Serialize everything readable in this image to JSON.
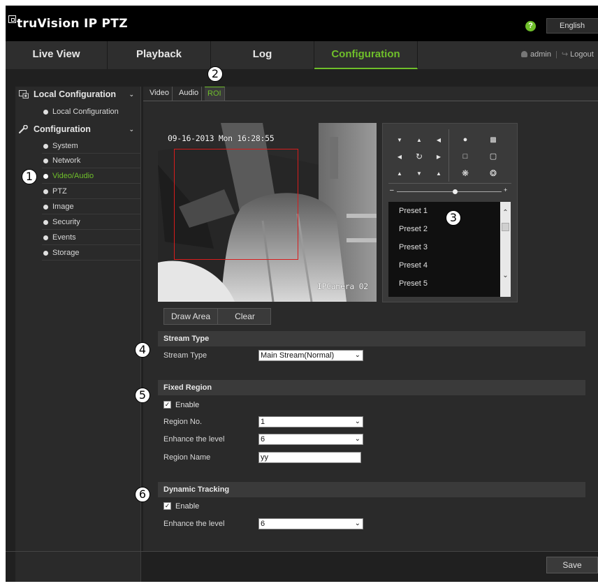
{
  "header": {
    "logo_text": "truVision IP PTZ",
    "help_icon": "question-icon",
    "language": "English"
  },
  "nav": {
    "tabs": [
      {
        "label": "Live View"
      },
      {
        "label": "Playback"
      },
      {
        "label": "Log"
      },
      {
        "label": "Configuration"
      }
    ],
    "active_tab": "Configuration",
    "user": "admin",
    "logout": "Logout"
  },
  "sidebar": {
    "local_heading": "Local Configuration",
    "local_items": [
      "Local Configuration"
    ],
    "config_heading": "Configuration",
    "config_items": [
      "System",
      "Network",
      "Video/Audio",
      "PTZ",
      "Image",
      "Security",
      "Events",
      "Storage"
    ],
    "active_item": "Video/Audio"
  },
  "subtabs": {
    "items": [
      "Video",
      "Audio",
      "ROI"
    ],
    "active": "ROI"
  },
  "video": {
    "osd_datetime": "09-16-2013 Mon 16:28:55",
    "osd_camera": "IPCamera 02"
  },
  "ptz": {
    "presets": [
      "Preset 1",
      "Preset 2",
      "Preset 3",
      "Preset 4",
      "Preset 5"
    ],
    "zoom_level": 0.55
  },
  "draw": {
    "draw_label": "Draw Area",
    "clear_label": "Clear"
  },
  "stream_type": {
    "heading": "Stream Type",
    "label": "Stream Type",
    "value": "Main Stream(Normal)"
  },
  "fixed_region": {
    "heading": "Fixed Region",
    "enable_label": "Enable",
    "enabled": true,
    "region_no_label": "Region No.",
    "region_no": "1",
    "enhance_label": "Enhance the level",
    "enhance": "6",
    "region_name_label": "Region Name",
    "region_name": "yy"
  },
  "dynamic_tracking": {
    "heading": "Dynamic Tracking",
    "enable_label": "Enable",
    "enabled": true,
    "enhance_label": "Enhance the level",
    "enhance": "6"
  },
  "callouts": [
    "1",
    "2",
    "3",
    "4",
    "5",
    "6"
  ],
  "footer": {
    "save_label": "Save"
  },
  "colors": {
    "accent": "#6fbf2a",
    "roi_box": "#d81c1c",
    "panel": "#2a2a2a",
    "topbar": "#000000"
  }
}
